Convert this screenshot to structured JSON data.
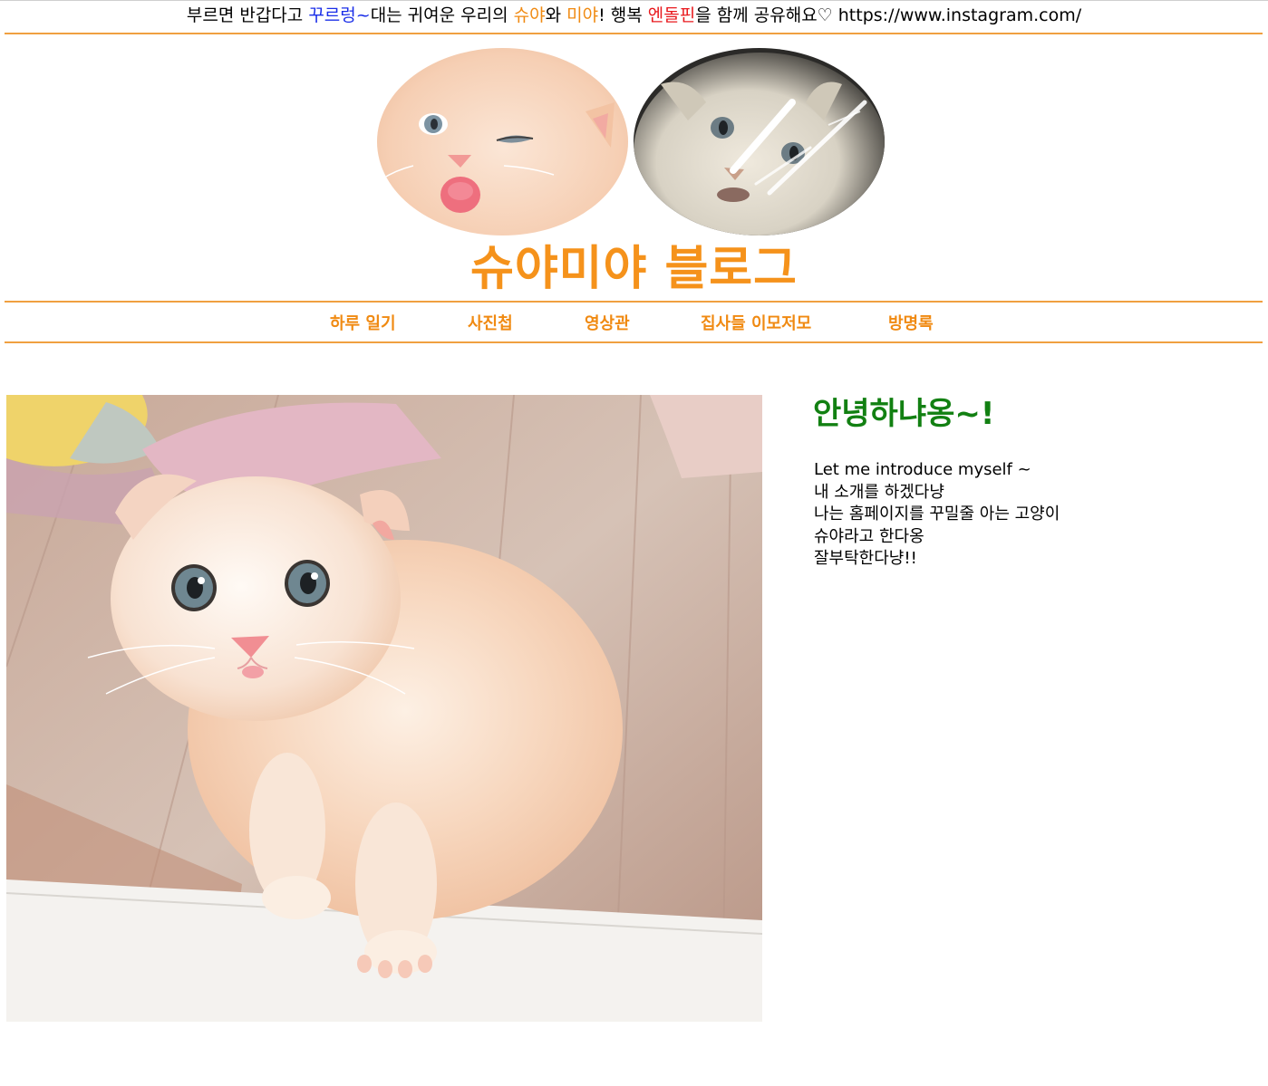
{
  "banner": {
    "segments": [
      {
        "text": "부르면 반갑다고 ",
        "color": "default"
      },
      {
        "text": "꾸르렁~",
        "color": "blue"
      },
      {
        "text": "대는 귀여운 우리의 ",
        "color": "default"
      },
      {
        "text": "슈야",
        "color": "orange"
      },
      {
        "text": "와 ",
        "color": "default"
      },
      {
        "text": "미야",
        "color": "orange"
      },
      {
        "text": "! 행복 ",
        "color": "default"
      },
      {
        "text": "엔돌핀",
        "color": "red"
      },
      {
        "text": "을 함께 공유해요♡ https://www.instagram.com/",
        "color": "default"
      }
    ]
  },
  "header": {
    "title": "슈야미야 블로그",
    "avatars": [
      "cat-shuya-avatar",
      "cat-miya-avatar"
    ]
  },
  "nav": {
    "items": [
      {
        "label": "하루 일기"
      },
      {
        "label": "사진첩"
      },
      {
        "label": "영상관"
      },
      {
        "label": "집사들 이모저모"
      },
      {
        "label": "방명록"
      }
    ]
  },
  "main": {
    "photo": "kitten-photo",
    "greeting": "안녕하냐옹~!",
    "intro_lines": [
      "Let me introduce myself ~",
      "내 소개를 하겠다냥",
      "나는 홈페이지를 꾸밀줄 아는 고양이",
      "슈야라고 한다옹",
      "잘부탁한다냥!!"
    ]
  },
  "colors": {
    "accent": "#f5921b",
    "rule": "#f0a040",
    "greeting": "#128012",
    "link_blue": "#1a2ee8",
    "highlight_red": "#e8181c"
  }
}
